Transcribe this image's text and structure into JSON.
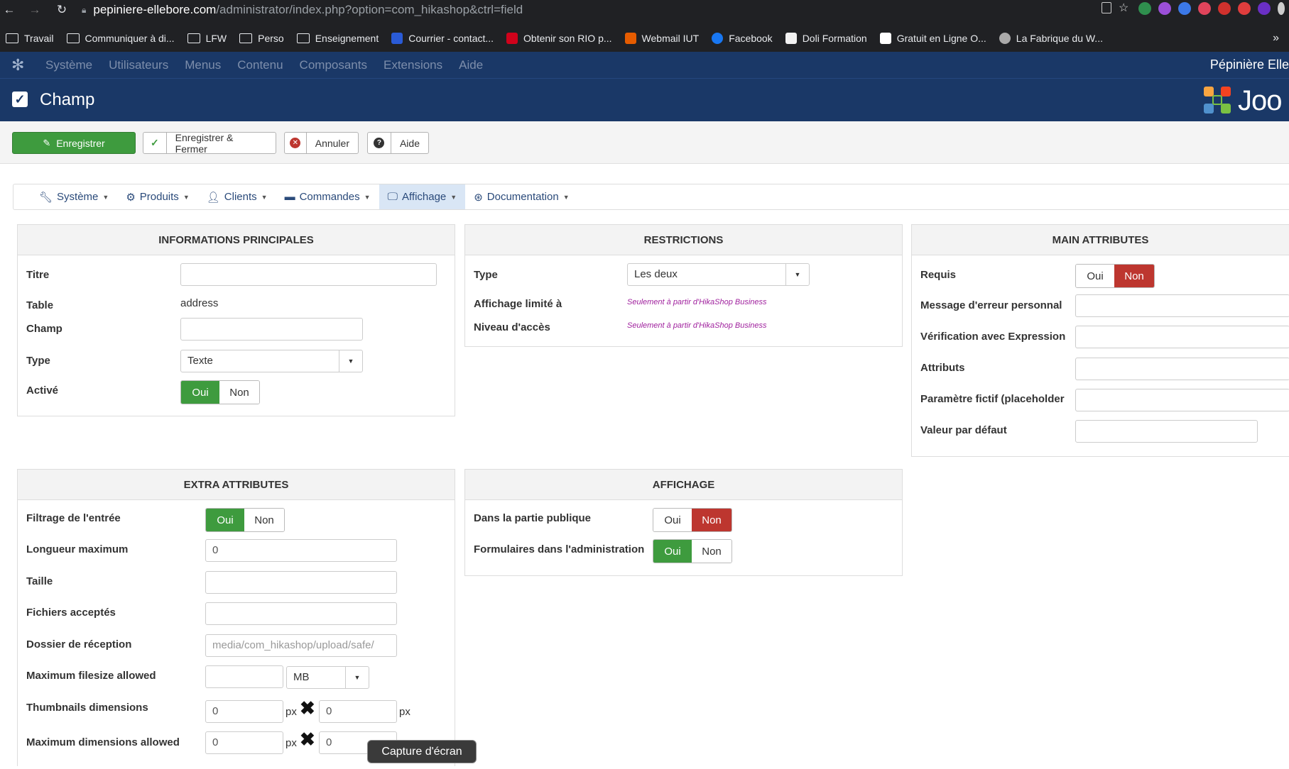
{
  "browser": {
    "url_host": "pepiniere-ellebore.com",
    "url_path": "/administrator/index.php?option=com_hikashop&ctrl=field",
    "bookmarks": [
      "Travail",
      "Communiquer à di...",
      "LFW",
      "Perso",
      "Enseignement",
      "Courrier - contact...",
      "Obtenir son RIO p...",
      "Webmail IUT",
      "Facebook",
      "Doli Formation",
      "Gratuit en Ligne O...",
      "La Fabrique du W..."
    ],
    "more": "»"
  },
  "jnav": {
    "menus": [
      "Système",
      "Utilisateurs",
      "Menus",
      "Contenu",
      "Composants",
      "Extensions",
      "Aide"
    ],
    "site": "Pépinière Elle"
  },
  "header": {
    "title": "Champ",
    "logo_text": "Joo"
  },
  "toolbar": {
    "save": "Enregistrer",
    "save_close": "Enregistrer & Fermer",
    "cancel": "Annuler",
    "help": "Aide"
  },
  "tabs": [
    "Système",
    "Produits",
    "Clients",
    "Commandes",
    "Affichage",
    "Documentation"
  ],
  "info": {
    "heading": "INFORMATIONS PRINCIPALES",
    "titre_label": "Titre",
    "titre_value": "",
    "table_label": "Table",
    "table_value": "address",
    "champ_label": "Champ",
    "champ_value": "",
    "type_label": "Type",
    "type_value": "Texte",
    "active_label": "Activé",
    "yes": "Oui",
    "no": "Non"
  },
  "restrictions": {
    "heading": "RESTRICTIONS",
    "type_label": "Type",
    "type_value": "Les deux",
    "affichage_label": "Affichage limité à",
    "affichage_hint": "Seulement à partir d'HikaShop Business",
    "niveau_label": "Niveau d'accès",
    "niveau_hint": "Seulement à partir d'HikaShop Business"
  },
  "main_attr": {
    "heading": "MAIN ATTRIBUTES",
    "requis_label": "Requis",
    "yes": "Oui",
    "no": "Non",
    "msg_label": "Message d'erreur personnal",
    "verif_label": "Vérification avec Expression",
    "attributs_label": "Attributs",
    "placeholder_label": "Paramètre fictif (placeholder",
    "default_label": "Valeur par défaut"
  },
  "extra": {
    "heading": "EXTRA ATTRIBUTES",
    "filtrage_label": "Filtrage de l'entrée",
    "yes": "Oui",
    "no": "Non",
    "longueur_label": "Longueur maximum",
    "longueur_value": "0",
    "taille_label": "Taille",
    "fichiers_label": "Fichiers acceptés",
    "dossier_label": "Dossier de réception",
    "dossier_placeholder": "media/com_hikashop/upload/safe/",
    "maxsize_label": "Maximum filesize allowed",
    "maxsize_unit": "MB",
    "thumb_label": "Thumbnails dimensions",
    "thumb_w": "0",
    "thumb_h": "0",
    "px": "px",
    "maxdim_label": "Maximum dimensions allowed",
    "maxdim_w": "0",
    "maxdim_h": "0"
  },
  "affichage": {
    "heading": "AFFICHAGE",
    "public_label": "Dans la partie publique",
    "admin_label": "Formulaires dans l'administration",
    "yes": "Oui",
    "no": "Non"
  },
  "tooltip": "Capture d'écran"
}
